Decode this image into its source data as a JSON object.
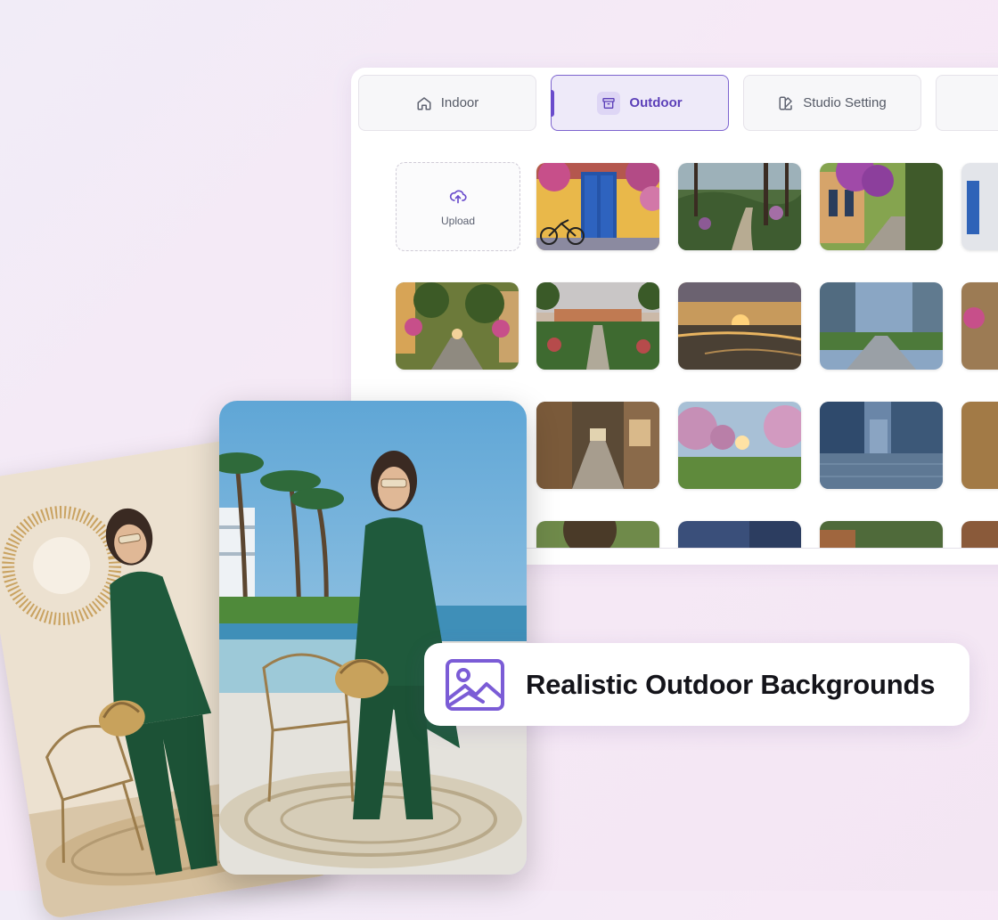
{
  "tabs": [
    {
      "label": "Indoor",
      "icon": "home-icon",
      "active": false
    },
    {
      "label": "Outdoor",
      "icon": "archive-icon",
      "active": true
    },
    {
      "label": "Studio Setting",
      "icon": "palette-icon",
      "active": false
    },
    {
      "label": "",
      "icon": "more-icon",
      "active": false
    }
  ],
  "upload": {
    "label": "Upload",
    "icon": "cloud-upload-icon"
  },
  "badge": {
    "label": "Realistic Outdoor Backgrounds",
    "icon": "image-icon"
  },
  "colors": {
    "accent": "#6a4ccc",
    "accent_light": "#eeeaf9",
    "background": "#f4eaf6"
  }
}
